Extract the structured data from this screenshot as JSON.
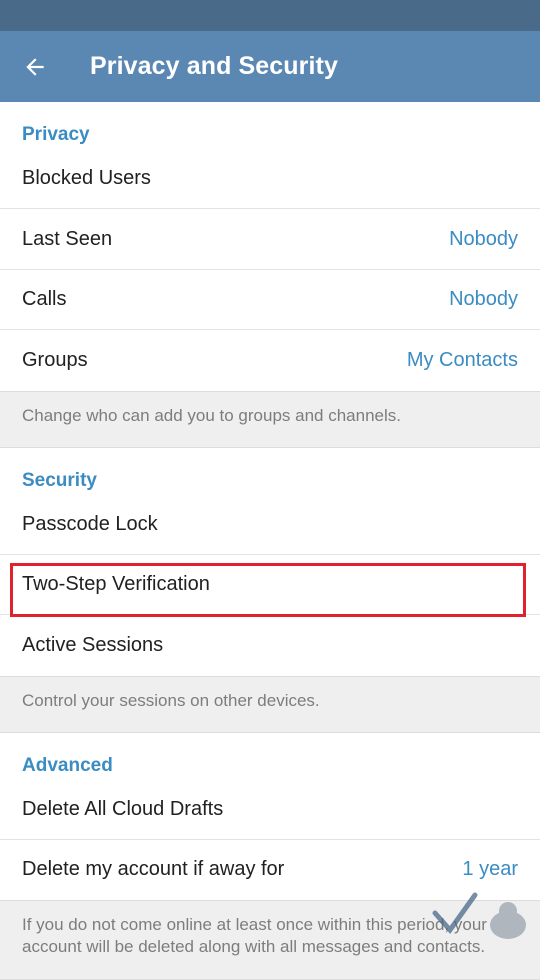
{
  "header": {
    "title": "Privacy and Security"
  },
  "privacy": {
    "header": "Privacy",
    "blocked_users": "Blocked Users",
    "last_seen": {
      "label": "Last Seen",
      "value": "Nobody"
    },
    "calls": {
      "label": "Calls",
      "value": "Nobody"
    },
    "groups": {
      "label": "Groups",
      "value": "My Contacts"
    },
    "info": "Change who can add you to groups and channels."
  },
  "security": {
    "header": "Security",
    "passcode_lock": "Passcode Lock",
    "two_step": "Two-Step Verification",
    "active_sessions": "Active Sessions",
    "info": "Control your sessions on other devices."
  },
  "advanced": {
    "header": "Advanced",
    "delete_drafts": "Delete All Cloud Drafts",
    "delete_account": {
      "label": "Delete my account if away for",
      "value": "1 year"
    },
    "info": "If you do not come online at least once within this period, your account will be deleted along with all messages and contacts."
  },
  "colors": {
    "app_bar": "#5a88b3",
    "status_bar": "#4a6a89",
    "accent": "#3a8cc2",
    "highlight": "#e0222c"
  }
}
